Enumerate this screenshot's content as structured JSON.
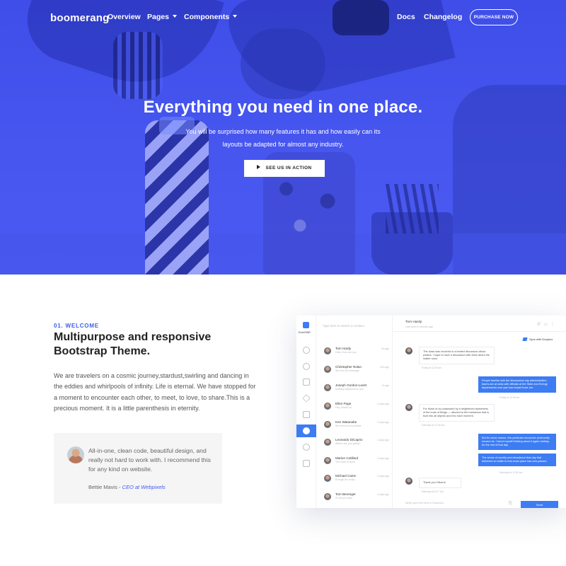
{
  "nav": {
    "logo": "boomerang",
    "links": [
      "Overview",
      "Pages",
      "Components",
      "Docs",
      "Changelog"
    ],
    "purchase_label": "PURCHASE NOW"
  },
  "hero": {
    "title": "Everything you need in one place.",
    "subtitle_line1": "You will be surprised how many features it has and how easily can its",
    "subtitle_line2": "layouts be adapted for almost any industry.",
    "cta_label": "SEE US IN ACTION"
  },
  "welcome": {
    "eyebrow": "01. WELCOME",
    "title": "Multipurpose and responsive Bootstrap Theme.",
    "body": "We are travelers on a cosmic journey,stardust,swirling and dancing in the eddies and whirlpools of infinity. Life is eternal. We have stopped for a moment to encounter each other, to meet, to love, to share.This is a precious moment. It is a little parenthesis in eternity."
  },
  "testimonial": {
    "quote": "All-in-one, clean code, beautiful design, and really not hard to work with. I recommend this for any kind on website.",
    "author": "Bettie Mavis",
    "separator": " - ",
    "role": "CEO at Webpixels"
  },
  "mockup": {
    "brand": "EverONE",
    "search_placeholder": "Type here to search a contact...",
    "contacts": [
      {
        "name": "Tom Hardy",
        "preview": "Hello, how are you",
        "time": "2m ago"
      },
      {
        "name": "Christopher Nolan",
        "preview": "See the full message",
        "time": "10m ago"
      },
      {
        "name": "Joseph Gordon-Levitt",
        "preview": "Nothing happened to you",
        "time": "1h ago"
      },
      {
        "name": "Ellen Page",
        "preview": "Hey, what's up",
        "time": "2 days ago"
      },
      {
        "name": "Ken Watanabe",
        "preview": "We need to be positive",
        "time": "2 days ago"
      },
      {
        "name": "Leonardo DiCaprio",
        "preview": "Where are you going?",
        "time": "2 days ago"
      },
      {
        "name": "Marion Cotillard",
        "preview": "The chair is stuck",
        "time": "3 days ago"
      },
      {
        "name": "Michael Caine",
        "preview": "Enough for today",
        "time": "4 days ago"
      },
      {
        "name": "Tom Berenger",
        "preview": "I'll call you later",
        "time": "5 days ago"
      }
    ],
    "chat_header_name": "Tom Hardy",
    "chat_header_sub": "Last seen 5 minutes ago",
    "dropbox_label": "Sync with Dropbox",
    "messages": [
      {
        "dir": "in",
        "text": "The class was involved in a heated discussion about politics. I hope to have a discussion with them about the matter soon.",
        "time": "Friday at 12:05 am"
      },
      {
        "dir": "out",
        "text": "People familiar with the discussions say administration teams are at odds with officials at the State and Energy departments over just how broad those are.",
        "time": "Friday at 12:05 am"
      },
      {
        "dir": "in",
        "text": "For those of us possessed by a heightened awareness of the ends of things — attuned to the transience that is built into all objects and into each moment.",
        "time": "Saturday at 12:05 am"
      },
      {
        "dir": "out",
        "text": "But for some reason, this particular encounter profoundly moved me. I found myself thinking about it again midday, for the rest of that day.",
        "time": ""
      },
      {
        "dir": "out",
        "text": "The sense of novelty and decadence that day that delivered an bottle to that exact place has now passed.",
        "time": "Saturday at 12:05 am"
      },
      {
        "dir": "in",
        "text": "Thank you Olivera!",
        "time": "Saturday at 8:27 am"
      }
    ],
    "composer_placeholder": "Write your text here in Diamond...",
    "send_label": "Send"
  }
}
